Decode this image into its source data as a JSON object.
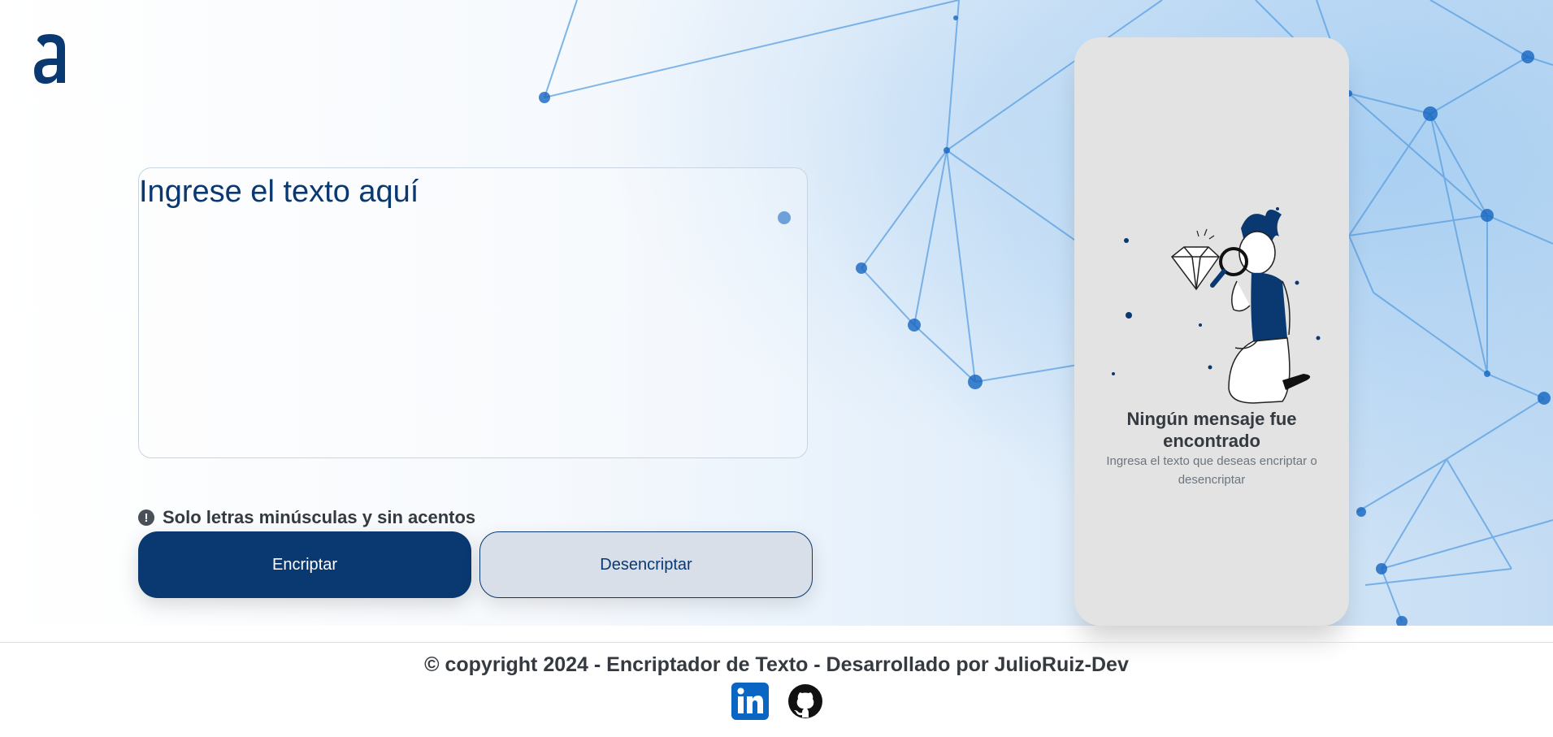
{
  "logo": {
    "letter": "a"
  },
  "input": {
    "placeholder": "Ingrese el texto aquí",
    "value": ""
  },
  "hint": {
    "text": "Solo letras minúsculas y sin acentos",
    "icon": "!"
  },
  "actions": {
    "encrypt_label": "Encriptar",
    "decrypt_label": "Desencriptar"
  },
  "output": {
    "title": "Ningún mensaje fue encontrado",
    "subtitle": "Ingresa el texto que deseas encriptar o desencriptar"
  },
  "footer": {
    "copyright": "© copyright 2024 - Encriptador de Texto - Desarrollado por JulioRuiz-Dev",
    "links": [
      {
        "name": "linkedin-icon"
      },
      {
        "name": "github-icon"
      }
    ]
  },
  "colors": {
    "primary": "#0a3871",
    "secondary": "#d8dfe8",
    "panel": "#e3e3e3",
    "text": "#343a40",
    "muted": "#6c757d"
  }
}
